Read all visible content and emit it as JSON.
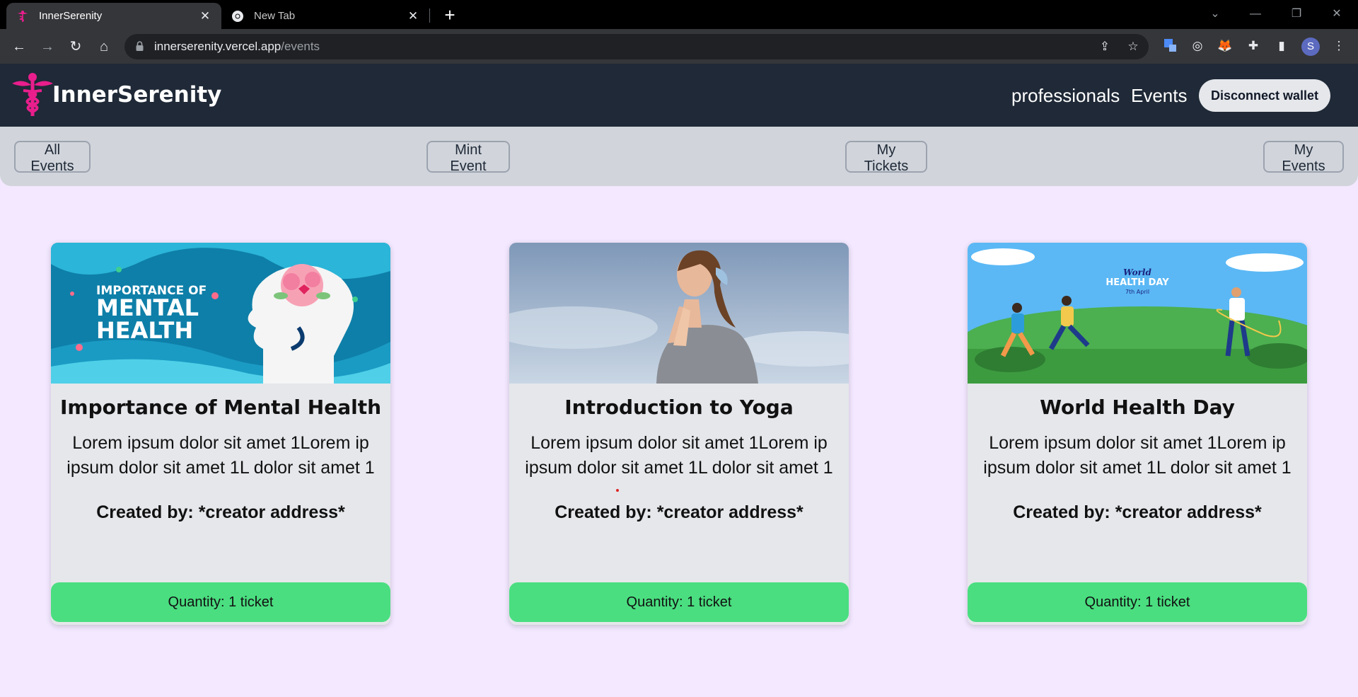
{
  "browser": {
    "tabs": [
      {
        "title": "InnerSerenity",
        "active": true
      },
      {
        "title": "New Tab",
        "active": false
      }
    ],
    "url_host": "innerserenity.vercel.app",
    "url_path": "/events",
    "profile_initial": "S"
  },
  "header": {
    "brand": "InnerSerenity",
    "nav": [
      "professionals",
      "Events"
    ],
    "wallet_button": "Disconnect wallet"
  },
  "subnav": {
    "buttons": [
      "All Events",
      "Mint Event",
      "My Tickets",
      "My Events"
    ]
  },
  "events": [
    {
      "title": "Importance of Mental Health",
      "description": "Lorem ipsum dolor sit amet 1Lorem ip ipsum dolor sit amet 1L dolor sit amet 1",
      "creator": "Created by: *creator address*",
      "quantity": "Quantity: 1 ticket",
      "image_text": [
        "IMPORTANCE OF",
        "MENTAL",
        "HEALTH"
      ]
    },
    {
      "title": "Introduction to Yoga",
      "description": "Lorem ipsum dolor sit amet 1Lorem ip ipsum dolor sit amet 1L dolor sit amet 1",
      "creator": "Created by: *creator address*",
      "quantity": "Quantity: 1 ticket"
    },
    {
      "title": "World Health Day",
      "description": "Lorem ipsum dolor sit amet 1Lorem ip ipsum dolor sit amet 1L dolor sit amet 1",
      "creator": "Created by: *creator address*",
      "quantity": "Quantity: 1 ticket",
      "image_text": [
        "World",
        "HEALTH DAY",
        "7th April"
      ]
    }
  ],
  "colors": {
    "header_bg": "#1f2937",
    "page_bg": "#f3e8ff",
    "subnav_bg": "#d1d5db",
    "card_bg": "#e5e7eb",
    "quantity_bg": "#4ade80",
    "logo_pink": "#e91e8c"
  }
}
